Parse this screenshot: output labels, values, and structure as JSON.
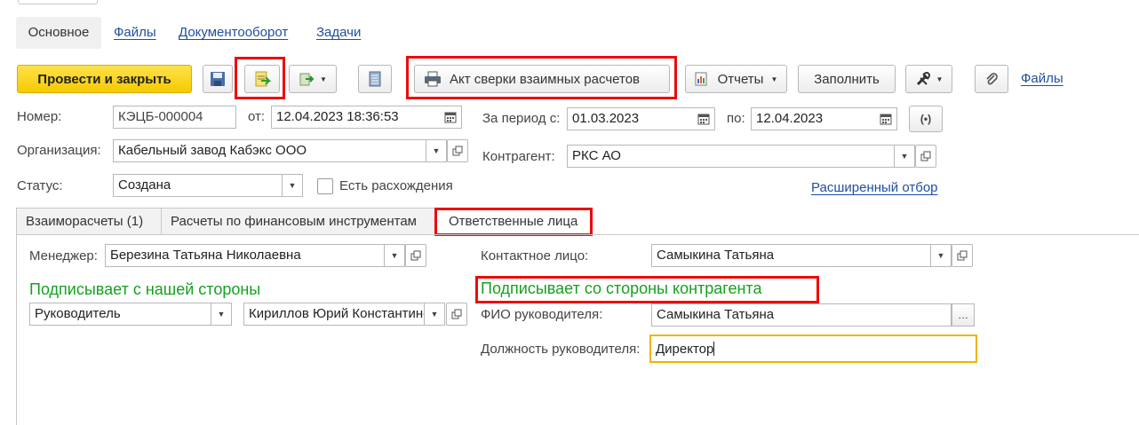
{
  "nav_tabs": {
    "main": "Основное",
    "files": "Файлы",
    "docflow": "Документооборот",
    "tasks": "Задачи"
  },
  "toolbar": {
    "post_close": "Провести и закрыть",
    "act_reconciliation": "Акт сверки взаимных расчетов",
    "reports": "Отчеты",
    "fill": "Заполнить",
    "files_link": "Файлы"
  },
  "form": {
    "number_label": "Номер:",
    "number_value": "КЭЦБ-000004",
    "from_label": "от:",
    "from_value": "12.04.2023 18:36:53",
    "period_label": "За период с:",
    "period_from": "01.03.2023",
    "period_to_label": "по:",
    "period_to": "12.04.2023",
    "org_label": "Организация:",
    "org_value": "Кабельный завод Кабэкс ООО",
    "counterparty_label": "Контрагент:",
    "counterparty_value": "РКС АО",
    "status_label": "Статус:",
    "status_value": "Создана",
    "discrepancy_label": "Есть расхождения",
    "advanced_filter": "Расширенный отбор"
  },
  "tabs": {
    "mutual": "Взаиморасчеты (1)",
    "financial": "Расчеты по финансовым инструментам",
    "responsible": "Ответственные лица"
  },
  "responsible": {
    "manager_label": "Менеджер:",
    "manager_value": "Березина Татьяна Николаевна",
    "contact_label": "Контактное лицо:",
    "contact_value": "Самыкина Татьяна",
    "our_side_heading": "Подписывает с нашей стороны",
    "our_role_value": "Руководитель",
    "our_person_value": "Кириллов Юрий Константинович",
    "their_side_heading": "Подписывает со стороны контрагента",
    "head_name_label": "ФИО руководителя:",
    "head_name_value": "Самыкина Татьяна",
    "head_position_label": "Должность руководителя:",
    "head_position_value": "Директор"
  },
  "colors": {
    "accent_yellow": "#f6c900",
    "link_blue": "#1f4e9f",
    "heading_green": "#15a11f",
    "highlight_red": "#ee0b0b",
    "focus_orange": "#f0b400"
  }
}
